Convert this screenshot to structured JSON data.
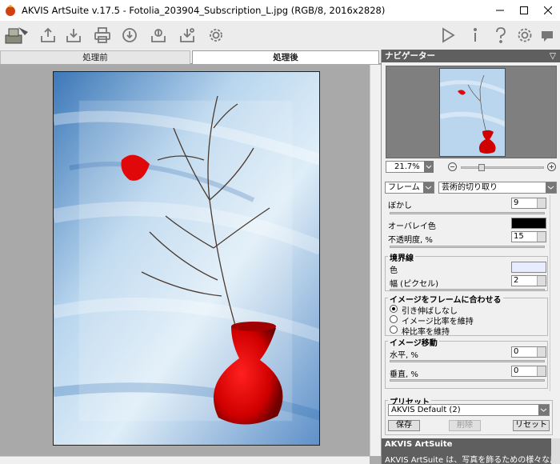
{
  "window": {
    "title": "AKVIS ArtSuite v.17.5 - Fotolia_203904_Subscription_L.jpg (RGB/8, 2016x2828)"
  },
  "toolbar": {
    "left_buttons": [
      "workspace-icon",
      "open-icon",
      "save-icon",
      "print-icon",
      "share-icon",
      "batch-icon",
      "export-icon",
      "preferences-icon"
    ],
    "right_buttons": [
      "run-icon",
      "info-icon",
      "help-icon",
      "settings-icon",
      "tooltip-icon"
    ]
  },
  "tabs": {
    "before": "処理前",
    "after": "処理後"
  },
  "navigator": {
    "header": "ナビゲーター",
    "zoom_value": "21.7%"
  },
  "settings": {
    "category": "フレーム",
    "frame_type": "芸術的切り取り",
    "blur_label": "ぼかし",
    "blur_value": "9",
    "overlay_color_label": "オーバレイ色",
    "opacity_label": "不透明度, %",
    "opacity_value": "15",
    "border_group": "境界線",
    "border_color_label": "色",
    "border_width_label": "幅 (ピクセル)",
    "border_width_value": "2",
    "fit_group": "イメージをフレームに合わせる",
    "fit_options": [
      "引き伸ばしなし",
      "イメージ比率を維持",
      "枠比率を維持"
    ],
    "fit_selected": 0,
    "move_group": "イメージ移動",
    "horizontal_label": "水平, %",
    "horizontal_value": "0",
    "vertical_label": "垂直, %",
    "vertical_value": "0",
    "overlay_color": "#000000",
    "border_color": "#e8ecff"
  },
  "presets": {
    "group": "プリセット",
    "selected": "AKVIS Default (2)",
    "save": "保存",
    "delete": "削除",
    "reset": "リセット"
  },
  "info": {
    "title": "AKVIS ArtSuite",
    "text": "AKVIS ArtSuite は、写真を飾るための様々な用途"
  }
}
